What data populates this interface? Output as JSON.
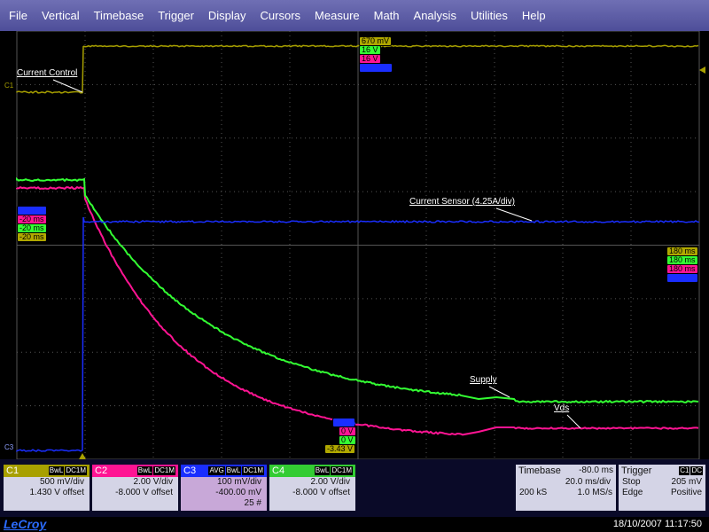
{
  "menu": [
    "File",
    "Vertical",
    "Timebase",
    "Trigger",
    "Display",
    "Cursors",
    "Measure",
    "Math",
    "Analysis",
    "Utilities",
    "Help"
  ],
  "colors": {
    "c1": "#a8a000",
    "c2": "#ff1493",
    "c3": "#1a2eff",
    "c4": "#33ff33",
    "grid": "#555555",
    "menu": "#5a5aa8"
  },
  "screen": {
    "label_current_control": "Current Control",
    "label_current_sensor": "Current Sensor (4.25A/div)",
    "label_supply": "Supply",
    "label_vds": "Vds",
    "label_c1": "C1",
    "label_c3": "C3"
  },
  "top_tags": [
    "670 mV",
    "16 V",
    "16 V",
    "4.9 A"
  ],
  "left_tags": [
    "-20 ms",
    "-20 ms",
    "-20 ms",
    "-20 ms"
  ],
  "right_tags": [
    "180 ms",
    "180 ms",
    "180 ms",
    "180 ms"
  ],
  "bottom_tags": [
    "-0.4 A",
    "0 V",
    "0 V",
    "-3.43 V"
  ],
  "channels": [
    {
      "name": "C1",
      "badges": [
        "BwL",
        "DC1M"
      ],
      "line1": "500 mV/div",
      "line2": "1.430 V offset",
      "line3": ""
    },
    {
      "name": "C2",
      "badges": [
        "BwL",
        "DC1M"
      ],
      "line1": "2.00 V/div",
      "line2": "-8.000 V offset",
      "line3": ""
    },
    {
      "name": "C3",
      "badges": [
        "AVG",
        "BwL",
        "DC1M"
      ],
      "line1": "100 mV/div",
      "line2": "-400.00 mV",
      "line3": "25 #"
    },
    {
      "name": "C4",
      "badges": [
        "BwL",
        "DC1M"
      ],
      "line1": "2.00 V/div",
      "line2": "-8.000 V offset",
      "line3": ""
    }
  ],
  "timebase": {
    "title": "Timebase",
    "delay": "-80.0 ms",
    "div": "20.0 ms/div",
    "samples": "200 kS",
    "rate": "1.0 MS/s"
  },
  "trigger": {
    "title": "Trigger",
    "badges": [
      "C1",
      "DC"
    ],
    "mode": "Stop",
    "level": "205 mV",
    "type": "Edge",
    "slope": "Positive"
  },
  "status": {
    "logo": "LeCroy",
    "datetime": "18/10/2007 11:17:50"
  }
}
